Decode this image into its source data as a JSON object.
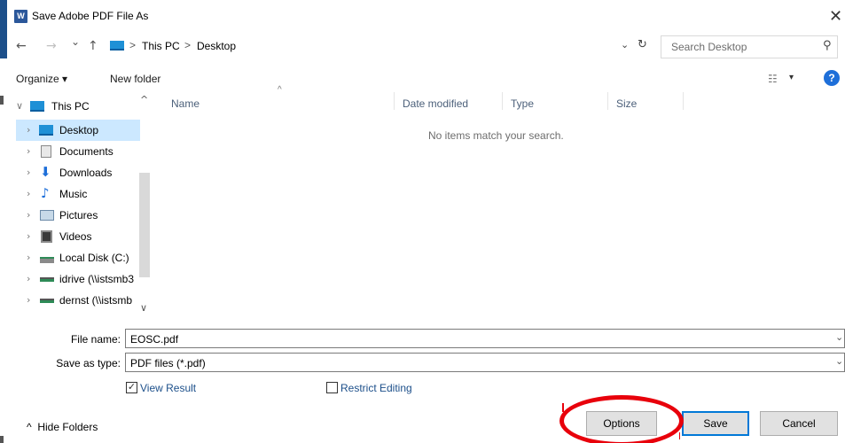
{
  "window": {
    "title": "Save Adobe PDF File As",
    "app_icon_text": "W",
    "close_icon": "close-icon"
  },
  "nav": {
    "back_icon": "←",
    "forward_icon": "→",
    "recent_icon": "⌄",
    "up_icon": "↑"
  },
  "address": {
    "crumbs": [
      "This PC",
      "Desktop"
    ],
    "separator": ">",
    "dropdown_icon": "⌄",
    "refresh_icon": "↻"
  },
  "search": {
    "placeholder": "Search Desktop",
    "icon": "⚲"
  },
  "toolbar": {
    "organize": "Organize ▾",
    "new_folder": "New folder",
    "view_icon": "☷",
    "view_dropdown": "▾",
    "help": "?"
  },
  "tree": {
    "root": "This PC",
    "items": [
      {
        "label": "Desktop"
      },
      {
        "label": "Documents"
      },
      {
        "label": "Downloads"
      },
      {
        "label": "Music"
      },
      {
        "label": "Pictures"
      },
      {
        "label": "Videos"
      },
      {
        "label": "Local Disk (C:)"
      },
      {
        "label": "idrive (\\\\istsmb3"
      },
      {
        "label": "dernst (\\\\istsmb"
      }
    ]
  },
  "columns": {
    "name": "Name",
    "date_modified": "Date modified",
    "type": "Type",
    "size": "Size"
  },
  "content": {
    "empty_message": "No items match your search."
  },
  "form": {
    "file_name_label": "File name:",
    "file_name_value": "EOSC.pdf",
    "save_type_label": "Save as type:",
    "save_type_value": "PDF files (*.pdf)",
    "dropdown_icon": "⌄"
  },
  "options": {
    "view_result": "View Result",
    "view_result_checked": true,
    "restrict_editing": "Restrict Editing",
    "restrict_editing_checked": false,
    "check_mark": "✓"
  },
  "footer": {
    "hide_folders": "Hide Folders",
    "hide_icon": "^",
    "options_button": "Options",
    "save_button": "Save",
    "cancel_button": "Cancel"
  },
  "colors": {
    "accent": "#0078d7",
    "annotation": "#e8000b",
    "selection": "#cce8ff"
  }
}
